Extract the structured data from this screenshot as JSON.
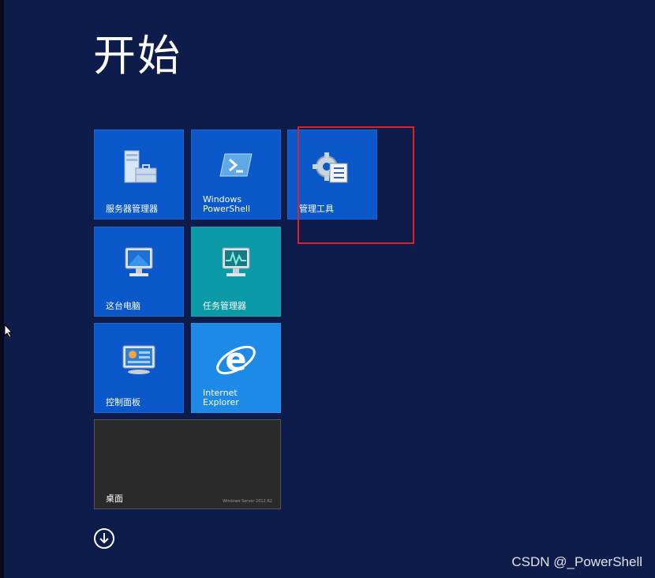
{
  "start_title": "开始",
  "tiles": {
    "server_manager": "服务器管理器",
    "powershell": "Windows\nPowerShell",
    "admin_tools": "管理工具",
    "this_pc": "这台电脑",
    "task_manager": "任务管理器",
    "control_panel": "控制面板",
    "ie": "Internet\nExplorer",
    "desktop": "桌面",
    "desktop_brand": "Windows Server 2012 R2"
  },
  "watermark": "CSDN @_PowerShell",
  "colors": {
    "background": "#0e1c4b",
    "tile_blue": "#0a58c9",
    "tile_teal": "#0a9aa8",
    "tile_ie": "#1c8ae6",
    "highlight": "#e02027"
  }
}
